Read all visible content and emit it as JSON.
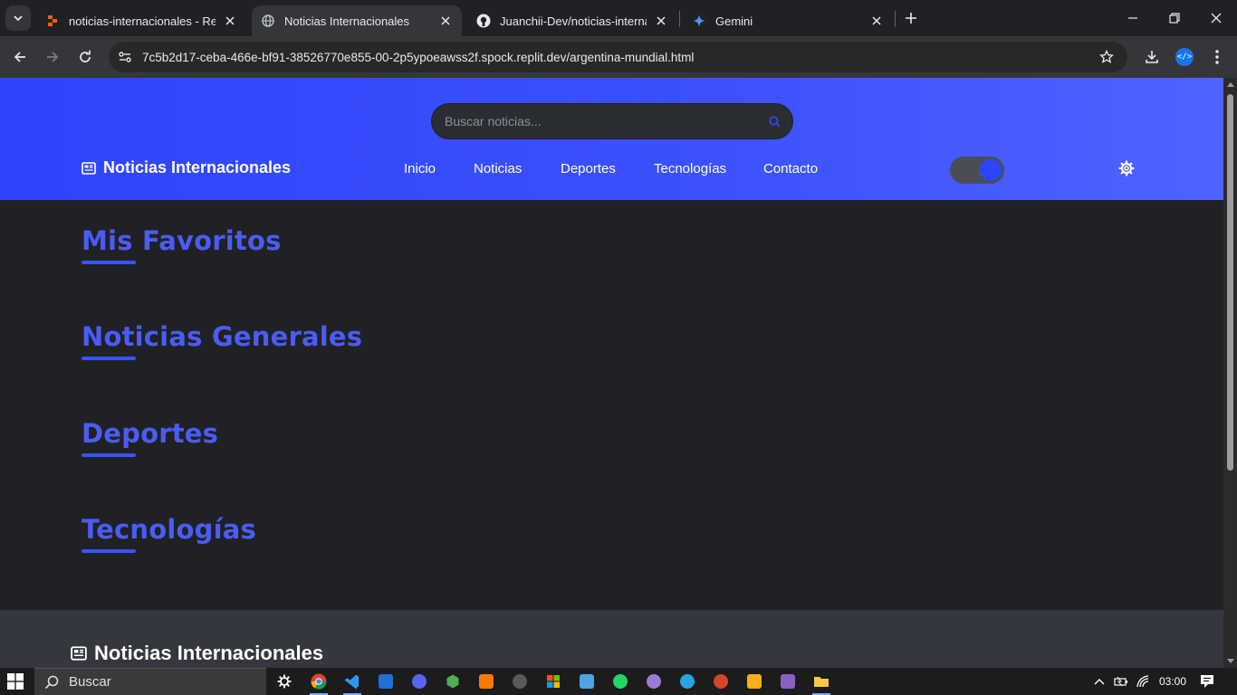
{
  "browser": {
    "tabs": [
      {
        "title": "noticias-internacionales - Replit",
        "favicon": "replit-icon"
      },
      {
        "title": "Noticias Internacionales",
        "favicon": "globe-icon"
      },
      {
        "title": "Juanchii-Dev/noticias-internacio",
        "favicon": "github-icon"
      },
      {
        "title": "Gemini",
        "favicon": "gemini-icon"
      }
    ],
    "active_tab": 1,
    "url": "7c5b2d17-ceba-466e-bf91-38526770e855-00-2p5ypoeawss2f.spock.replit.dev/argentina-mundial.html"
  },
  "site": {
    "search_placeholder": "Buscar noticias...",
    "brand": "Noticias Internacionales",
    "nav": [
      "Inicio",
      "Noticias",
      "Deportes",
      "Tecnologías",
      "Contacto"
    ],
    "sections": [
      "Mis Favoritos",
      "Noticias Generales",
      "Deportes",
      "Tecnologías"
    ],
    "footer_brand": "Noticias Internacionales",
    "theme_toggle_on": true
  },
  "taskbar": {
    "search_label": "Buscar",
    "time": "03:00"
  },
  "colors": {
    "header_start": "#2f44fb",
    "header_end": "#4e63ff",
    "accent": "#4a5cf4",
    "page_bg": "#202124"
  }
}
